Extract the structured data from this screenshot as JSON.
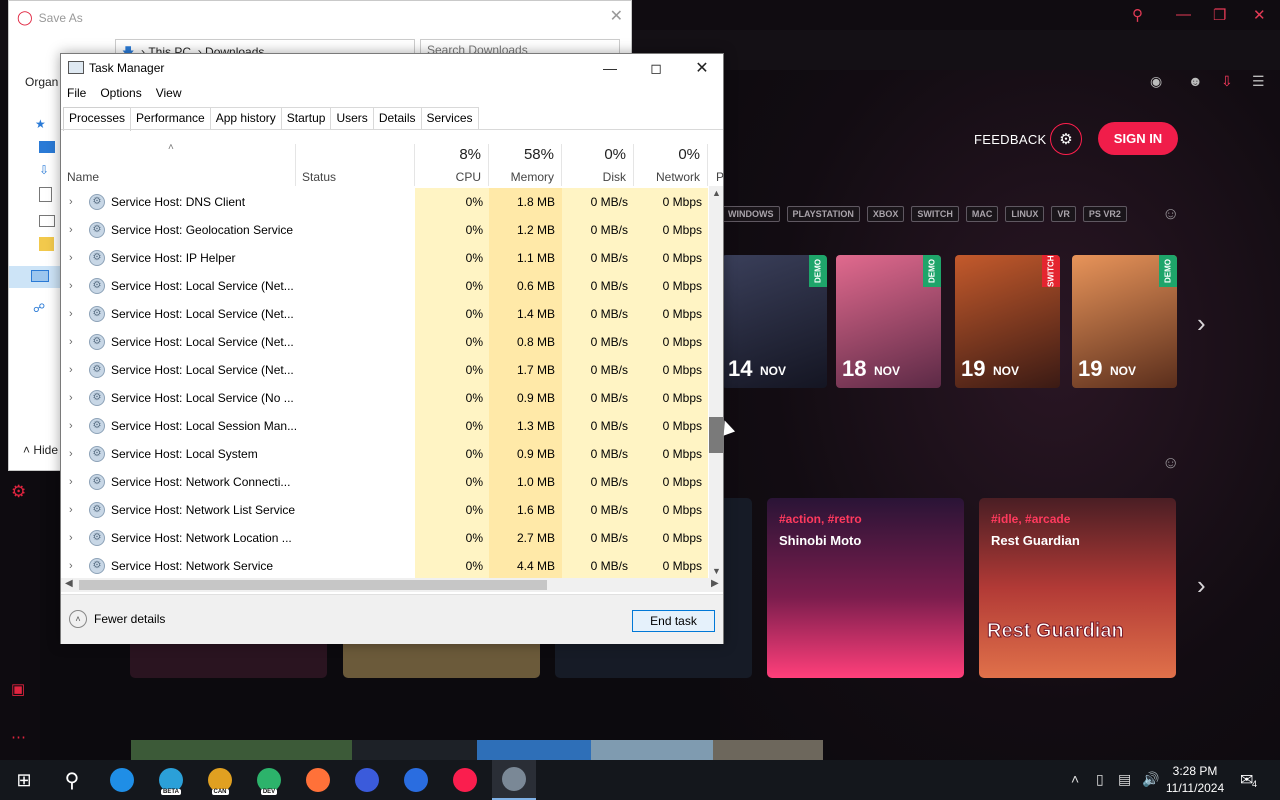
{
  "browser": {
    "feedback_label": "FEEDBACK",
    "signin_label": "SIGN IN",
    "platforms": [
      "WINDOWS",
      "PLAYSTATION",
      "XBOX",
      "SWITCH",
      "MAC",
      "LINUX",
      "VR",
      "PS VR2"
    ],
    "calendar": [
      {
        "day": "14",
        "month": "NOV",
        "badge": "DEMO",
        "color": "#2b2f47"
      },
      {
        "day": "18",
        "month": "NOV",
        "badge": "DEMO",
        "color": "#b45576"
      },
      {
        "day": "19",
        "month": "NOV",
        "badge": "SWITCH",
        "color": "#7a3a22"
      },
      {
        "day": "19",
        "month": "NOV",
        "badge": "DEMO",
        "color": "#c8734a"
      }
    ],
    "games": [
      {
        "tags": "#action, #retro",
        "title": "Shinobi Moto"
      },
      {
        "tags": "#idle, #arcade",
        "title": "Rest Guardian",
        "art_text": "Rest Guardian"
      }
    ]
  },
  "save_as": {
    "title": "Save As",
    "path_root": "This PC",
    "path_folder": "Downloads",
    "search_placeholder": "Search Downloads",
    "organize_label": "Organ",
    "hide_label": "Hide"
  },
  "task_manager": {
    "title": "Task Manager",
    "menu": [
      "File",
      "Options",
      "View"
    ],
    "tabs": [
      "Processes",
      "Performance",
      "App history",
      "Startup",
      "Users",
      "Details",
      "Services"
    ],
    "active_tab": "Processes",
    "columns": {
      "name": "Name",
      "status": "Status",
      "cpu_pct": "8%",
      "cpu": "CPU",
      "mem_pct": "58%",
      "mem": "Memory",
      "disk_pct": "0%",
      "disk": "Disk",
      "net_pct": "0%",
      "net": "Network",
      "extra": "P"
    },
    "rows": [
      {
        "name": "Service Host: DNS Client",
        "cpu": "0%",
        "mem": "1.8 MB",
        "disk": "0 MB/s",
        "net": "0 Mbps"
      },
      {
        "name": "Service Host: Geolocation Service",
        "cpu": "0%",
        "mem": "1.2 MB",
        "disk": "0 MB/s",
        "net": "0 Mbps"
      },
      {
        "name": "Service Host: IP Helper",
        "cpu": "0%",
        "mem": "1.1 MB",
        "disk": "0 MB/s",
        "net": "0 Mbps"
      },
      {
        "name": "Service Host: Local Service (Net...",
        "cpu": "0%",
        "mem": "0.6 MB",
        "disk": "0 MB/s",
        "net": "0 Mbps"
      },
      {
        "name": "Service Host: Local Service (Net...",
        "cpu": "0%",
        "mem": "1.4 MB",
        "disk": "0 MB/s",
        "net": "0 Mbps"
      },
      {
        "name": "Service Host: Local Service (Net...",
        "cpu": "0%",
        "mem": "0.8 MB",
        "disk": "0 MB/s",
        "net": "0 Mbps"
      },
      {
        "name": "Service Host: Local Service (Net...",
        "cpu": "0%",
        "mem": "1.7 MB",
        "disk": "0 MB/s",
        "net": "0 Mbps"
      },
      {
        "name": "Service Host: Local Service (No ...",
        "cpu": "0%",
        "mem": "0.9 MB",
        "disk": "0 MB/s",
        "net": "0 Mbps"
      },
      {
        "name": "Service Host: Local Session Man...",
        "cpu": "0%",
        "mem": "1.3 MB",
        "disk": "0 MB/s",
        "net": "0 Mbps"
      },
      {
        "name": "Service Host: Local System",
        "cpu": "0%",
        "mem": "0.9 MB",
        "disk": "0 MB/s",
        "net": "0 Mbps"
      },
      {
        "name": "Service Host: Network Connecti...",
        "cpu": "0%",
        "mem": "1.0 MB",
        "disk": "0 MB/s",
        "net": "0 Mbps"
      },
      {
        "name": "Service Host: Network List Service",
        "cpu": "0%",
        "mem": "1.6 MB",
        "disk": "0 MB/s",
        "net": "0 Mbps"
      },
      {
        "name": "Service Host: Network Location ...",
        "cpu": "0%",
        "mem": "2.7 MB",
        "disk": "0 MB/s",
        "net": "0 Mbps"
      },
      {
        "name": "Service Host: Network Service",
        "cpu": "0%",
        "mem": "4.4 MB",
        "disk": "0 MB/s",
        "net": "0 Mbps"
      }
    ],
    "fewer_details_label": "Fewer details",
    "end_task_label": "End task"
  },
  "taskbar": {
    "time": "3:28 PM",
    "date": "11/11/2024",
    "notification_count": "4",
    "apps": [
      {
        "icon": "edge-icon",
        "color": "#1f8ee6"
      },
      {
        "icon": "edge-beta-icon",
        "color": "#2ba0d8",
        "badge": "BETA"
      },
      {
        "icon": "edge-canary-icon",
        "color": "#e0a021",
        "badge": "CAN"
      },
      {
        "icon": "edge-dev-icon",
        "color": "#2cb36b",
        "badge": "DEV"
      },
      {
        "icon": "firefox-icon",
        "color": "#ff7139"
      },
      {
        "icon": "firefox-dev-icon",
        "color": "#3b5bdb"
      },
      {
        "icon": "firefox-nightly-icon",
        "color": "#2a6de0"
      },
      {
        "icon": "opera-gx-icon",
        "color": "#fa1e4e"
      },
      {
        "icon": "task-manager-icon",
        "color": "#7a8896"
      }
    ]
  }
}
